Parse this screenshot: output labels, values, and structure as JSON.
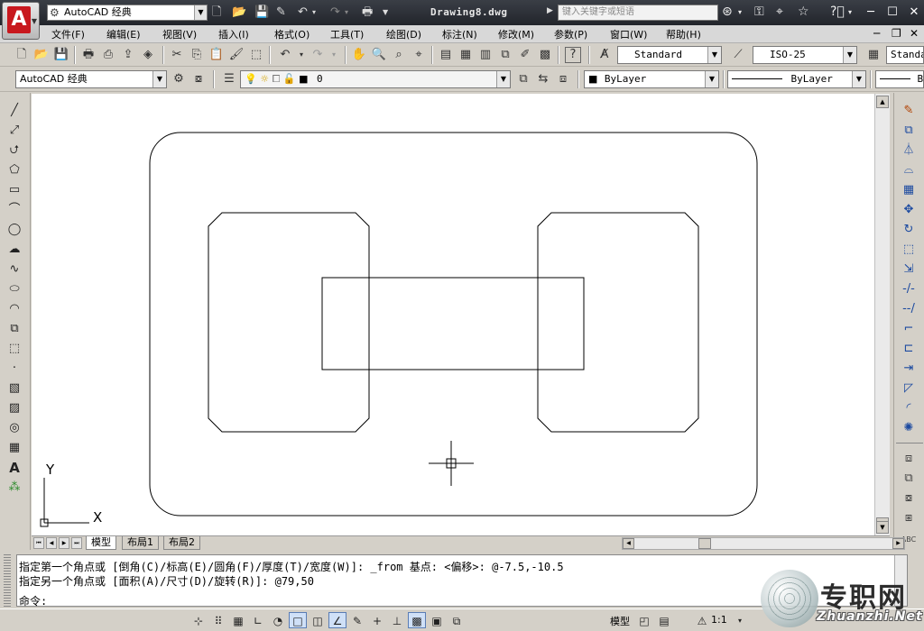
{
  "title_bar": {
    "workspace": "AutoCAD 经典",
    "doc_title": "Drawing8.dwg",
    "search_placeholder": "键入关键字或短语"
  },
  "menu": {
    "items": [
      "文件(F)",
      "编辑(E)",
      "视图(V)",
      "插入(I)",
      "格式(O)",
      "工具(T)",
      "绘图(D)",
      "标注(N)",
      "修改(M)",
      "参数(P)",
      "窗口(W)",
      "帮助(H)"
    ]
  },
  "styles_toolbar": {
    "text_style": "Standard",
    "dim_style": "ISO-25",
    "table_style": "Standard"
  },
  "workspace_toolbar": {
    "workspace": "AutoCAD 经典"
  },
  "layers_toolbar": {
    "layer": "0"
  },
  "properties_toolbar": {
    "color": "ByLayer",
    "linetype": "ByLayer",
    "lineweight": "B"
  },
  "layout_tabs": [
    "模型",
    "布局1",
    "布局2"
  ],
  "ucs": {
    "x_label": "X",
    "y_label": "Y"
  },
  "command_line": {
    "line1": "指定第一个角点或 [倒角(C)/标高(E)/圆角(F)/厚度(T)/宽度(W)]: _from 基点: <偏移>: @-7.5,-10.5",
    "line2": "指定另一个角点或 [面积(A)/尺寸(D)/旋转(R)]: @79,50",
    "prompt": "命令:"
  },
  "status_bar": {
    "model_label": "模型",
    "scale": "1:1"
  },
  "watermark": {
    "text": "专职网",
    "url": "Zhuanzhi.Net"
  }
}
